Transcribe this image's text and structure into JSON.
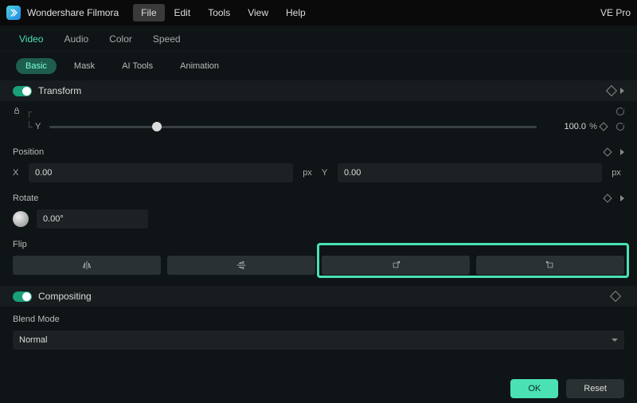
{
  "app": {
    "title": "Wondershare Filmora",
    "right": "VE Pro"
  },
  "menu": [
    "File",
    "Edit",
    "Tools",
    "View",
    "Help"
  ],
  "menu_active_index": 0,
  "tabs_primary": [
    "Video",
    "Audio",
    "Color",
    "Speed"
  ],
  "tabs_primary_active": 0,
  "tabs_secondary": [
    "Basic",
    "Mask",
    "AI Tools",
    "Animation"
  ],
  "tabs_secondary_active": 0,
  "transform": {
    "label": "Transform",
    "scale_y": {
      "axis": "Y",
      "value": "100.0",
      "unit": "%",
      "slider_pct": 22
    },
    "position": {
      "label": "Position",
      "x_axis": "X",
      "x_value": "0.00",
      "y_axis": "Y",
      "y_value": "0.00",
      "unit": "px"
    },
    "rotate": {
      "label": "Rotate",
      "value": "0.00°"
    },
    "flip": {
      "label": "Flip"
    }
  },
  "compositing": {
    "label": "Compositing",
    "blend_mode": {
      "label": "Blend Mode",
      "value": "Normal"
    }
  },
  "footer": {
    "ok": "OK",
    "reset": "Reset"
  }
}
